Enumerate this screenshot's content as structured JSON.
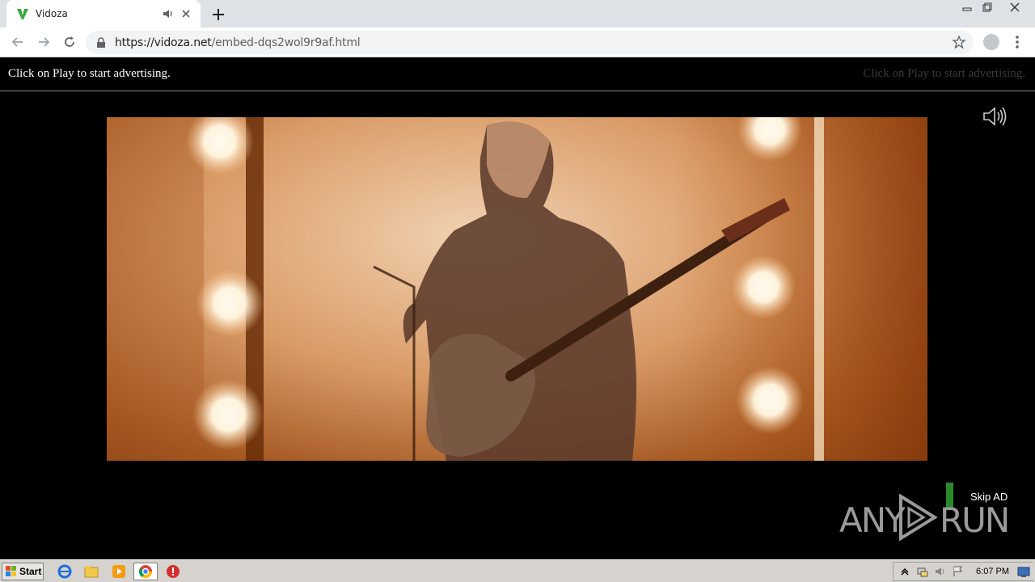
{
  "browser": {
    "tab_title": "Vidoza",
    "url_host": "https://vidoza.net",
    "url_path": "/embed-dqs2wol9r9af.html"
  },
  "page": {
    "ad_text_left": "Click on Play to start advertising.",
    "ad_text_right": "Click on Play to start advertising.",
    "skip_label": "Skip AD",
    "watermark_left": "ANY",
    "watermark_right": "RUN"
  },
  "taskbar": {
    "start_label": "Start",
    "clock": "6:07 PM"
  },
  "colors": {
    "accent_green": "#2a8a2a",
    "tab_bg": "#dee1e6"
  }
}
